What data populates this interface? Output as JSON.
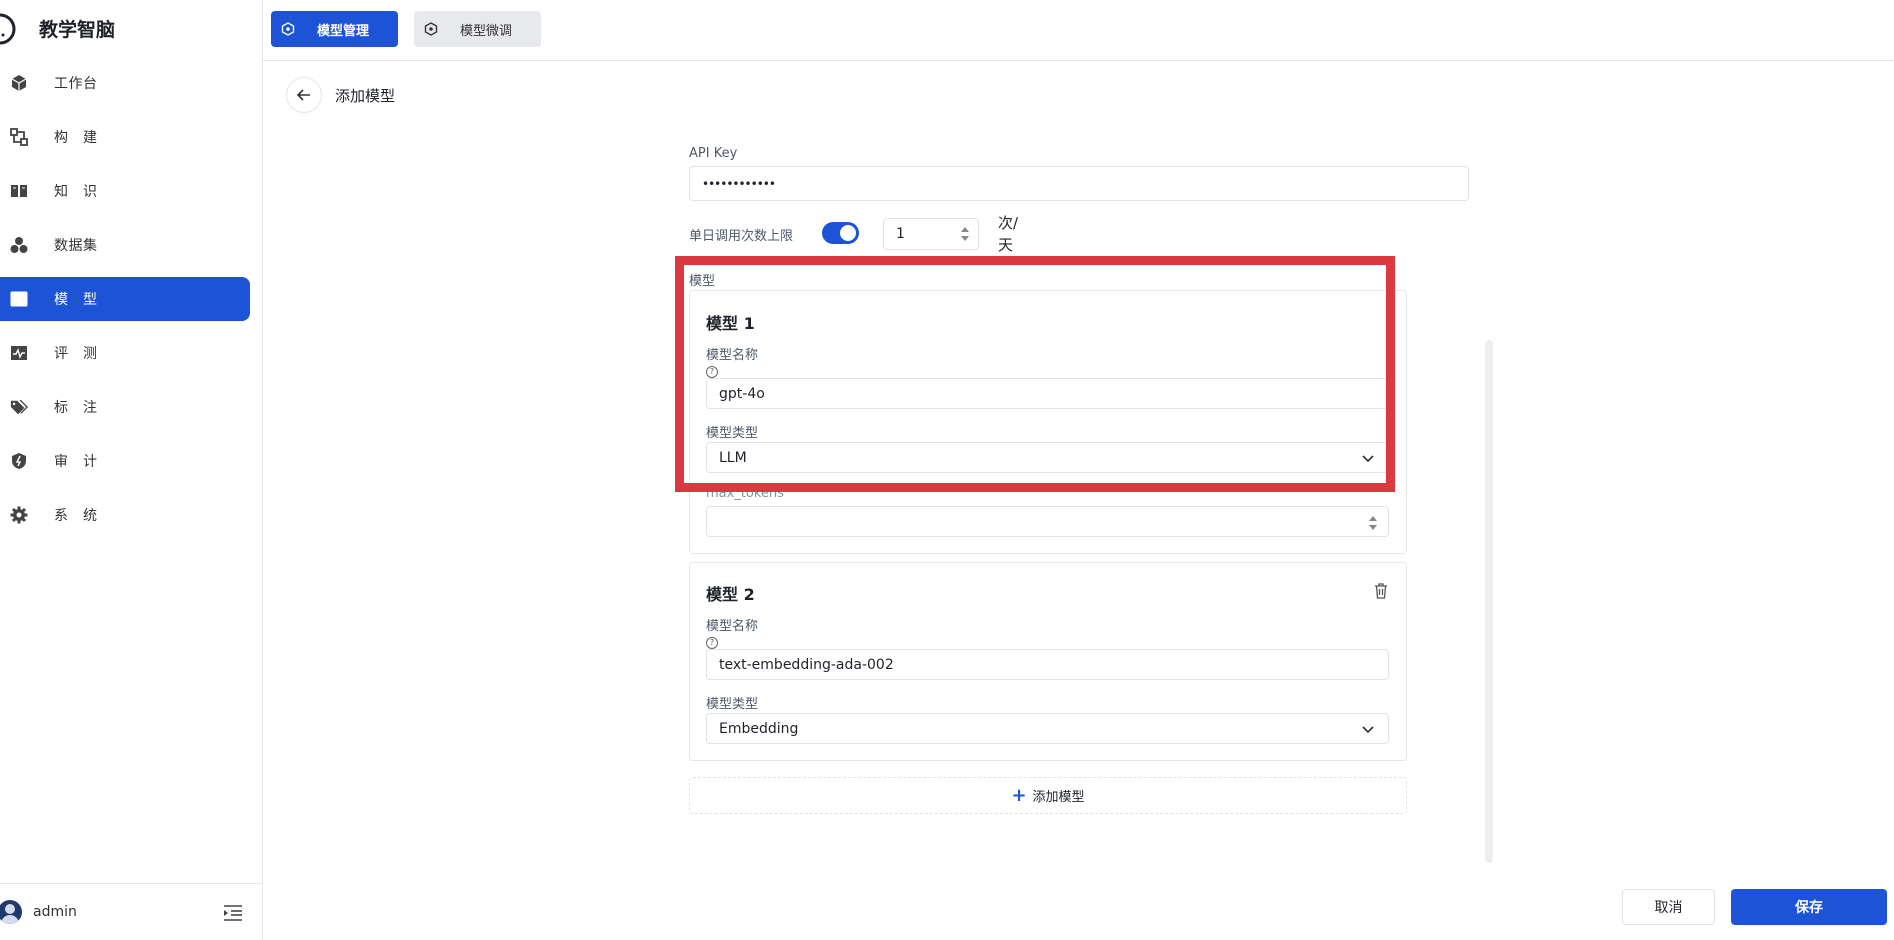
{
  "app": {
    "title": "教学智脑"
  },
  "sidebar": {
    "items": [
      {
        "label": "工作台",
        "icon": "cube-icon"
      },
      {
        "label": "构　建",
        "icon": "flow-icon"
      },
      {
        "label": "知　识",
        "icon": "book-icon"
      },
      {
        "label": "数据集",
        "icon": "cubes-icon"
      },
      {
        "label": "模　型",
        "icon": "model-icon",
        "active": true
      },
      {
        "label": "评　测",
        "icon": "pulse-icon"
      },
      {
        "label": "标　注",
        "icon": "tag-icon"
      },
      {
        "label": "审　计",
        "icon": "shield-icon"
      },
      {
        "label": "系　统",
        "icon": "gear-icon"
      }
    ],
    "user": {
      "name": "admin"
    }
  },
  "topbar": {
    "tabs": [
      {
        "label": "模型管理",
        "active": true
      },
      {
        "label": "模型微调",
        "active": false
      }
    ]
  },
  "page": {
    "title": "添加模型"
  },
  "form": {
    "api_key": {
      "label": "API Key",
      "value": "••••••••••••"
    },
    "daily_limit": {
      "label": "单日调用次数上限",
      "enabled": true,
      "value": "1",
      "unit": "次/天"
    },
    "models_label": "模型",
    "models": [
      {
        "title": "模型 1",
        "name_label": "模型名称",
        "name_value": "gpt-4o",
        "type_label": "模型类型",
        "type_value": "LLM",
        "max_tokens_label": "max_tokens"
      },
      {
        "title": "模型 2",
        "name_label": "模型名称",
        "name_value": "text-embedding-ada-002",
        "type_label": "模型类型",
        "type_value": "Embedding"
      }
    ],
    "add_model_label": "添加模型",
    "help_glyph": "?"
  },
  "footer": {
    "cancel": "取消",
    "save": "保存"
  },
  "colors": {
    "primary": "#1d53d6",
    "highlight": "#d9393f"
  }
}
